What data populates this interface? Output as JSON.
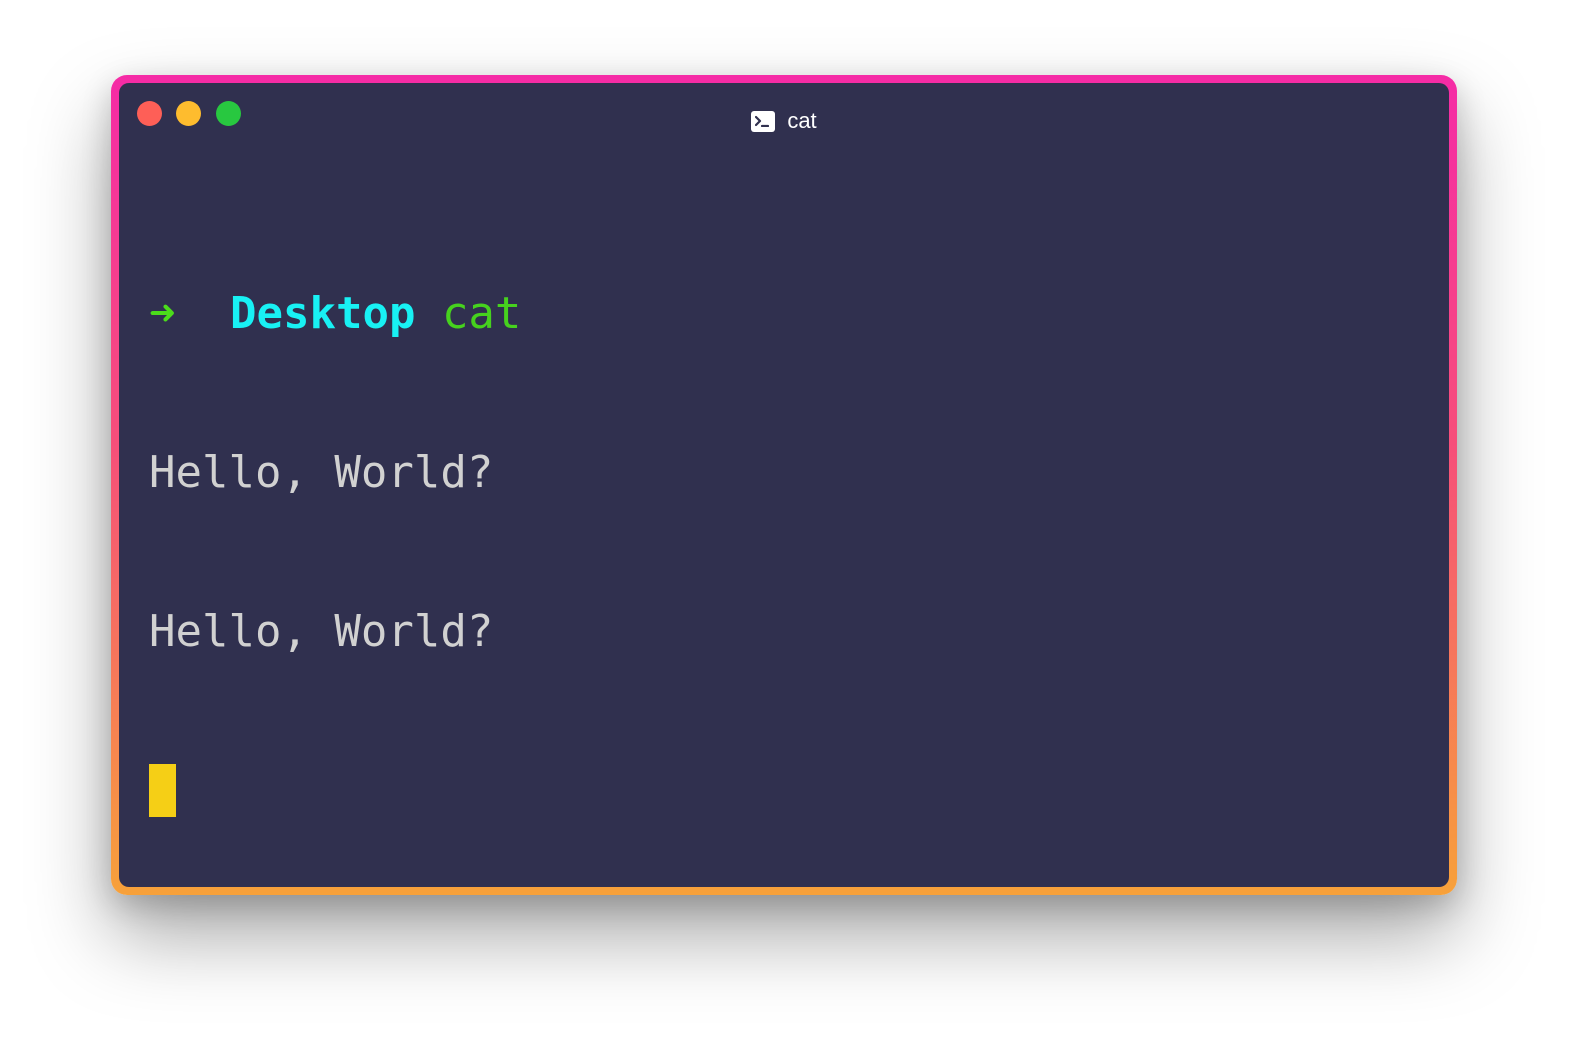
{
  "window": {
    "title": "cat",
    "title_icon": "terminal-icon",
    "traffic_lights": {
      "close": "#fe5f57",
      "minimize": "#febc2e",
      "zoom": "#28c840"
    }
  },
  "terminal": {
    "prompt": {
      "symbol": "➜",
      "directory": "Desktop",
      "command": "cat"
    },
    "output": [
      "Hello, World?",
      "Hello, World?"
    ],
    "cursor_color": "#f5cf16"
  },
  "colors": {
    "background": "#30304f",
    "prompt_arrow": "#4bdc1b",
    "directory": "#18f1f4",
    "command": "#46d21e",
    "output": "#d1d1d1",
    "border_top": "#f52ba6",
    "border_bottom": "#f7a13a"
  }
}
